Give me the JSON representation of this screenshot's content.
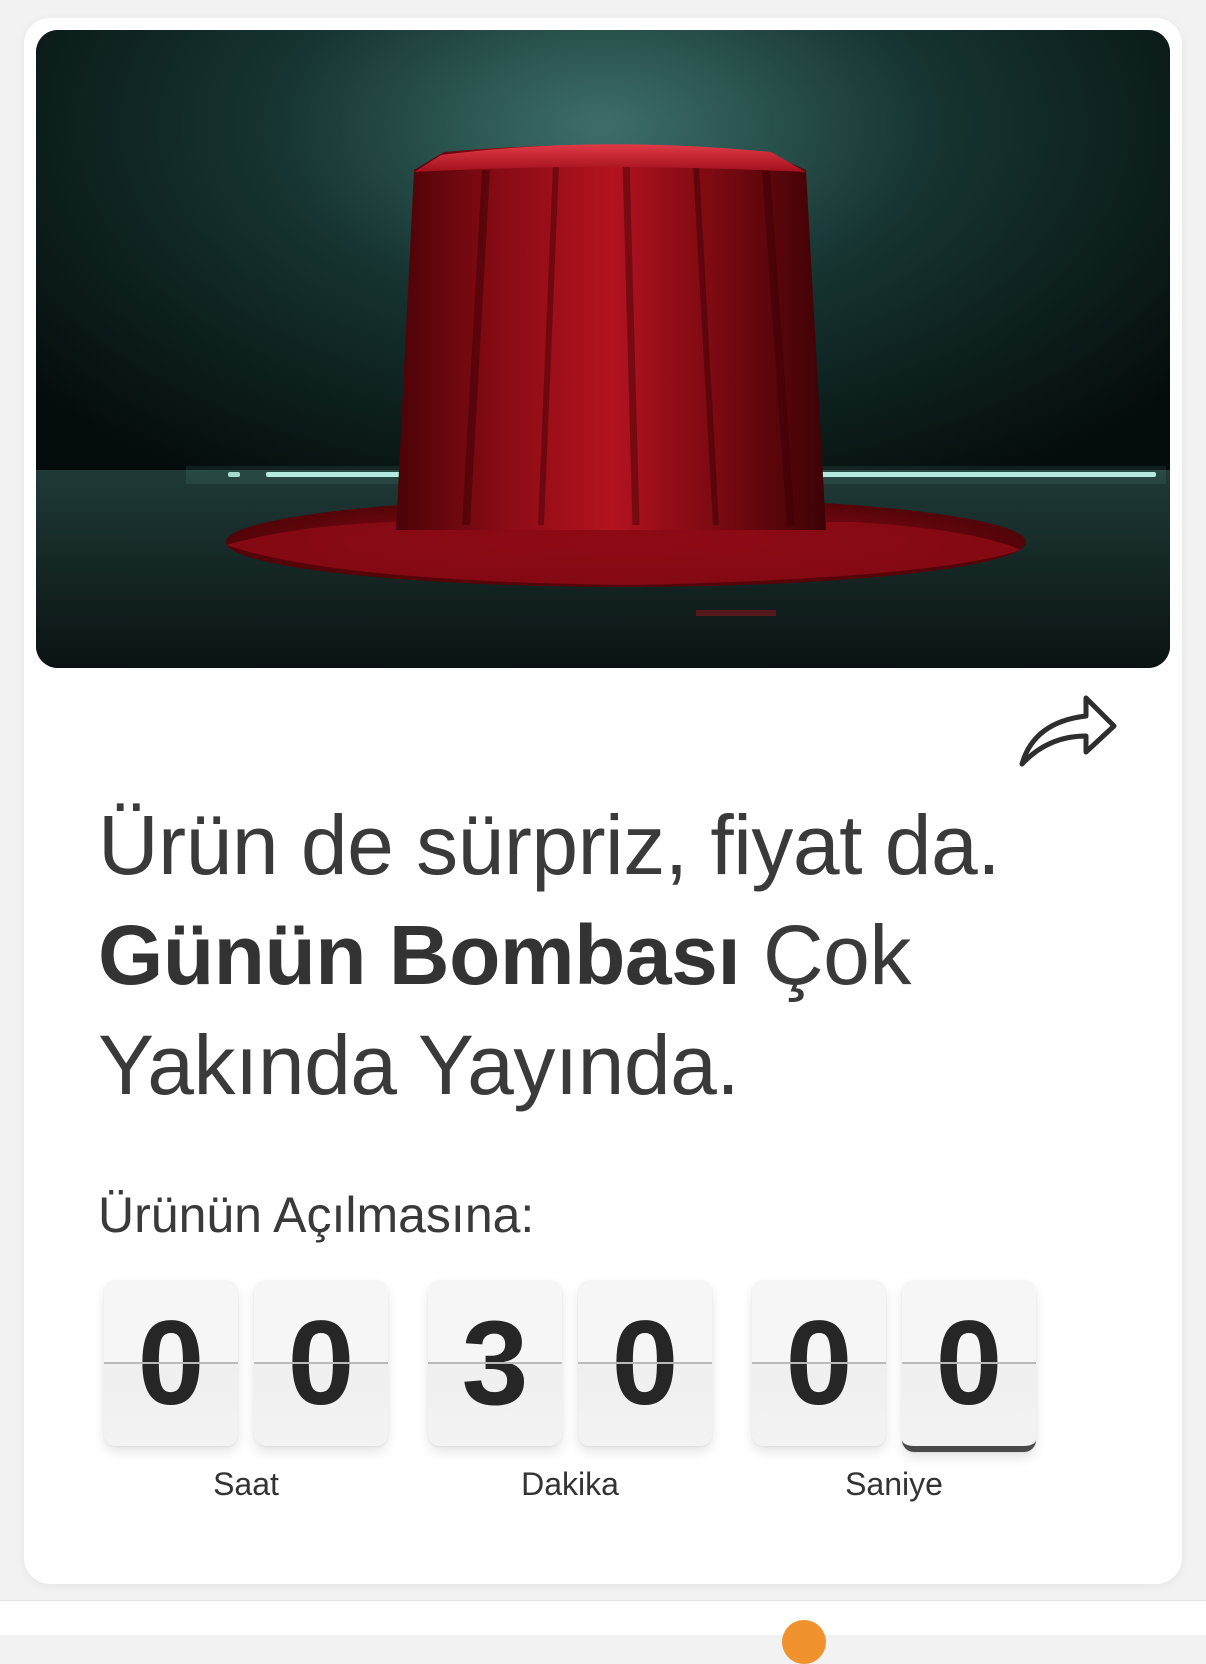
{
  "headline": {
    "line1": "Ürün de sürpriz, fiyat da.",
    "bold": "Günün Bombası",
    "rest1": " Çok",
    "line3": "Yakında Yayında."
  },
  "countdown": {
    "label": "Ürünün Açılmasına:",
    "digits": [
      "0",
      "0",
      "3",
      "0",
      "0",
      "0"
    ],
    "units": [
      "Saat",
      "Dakika",
      "Saniye"
    ]
  },
  "icons": {
    "share": "share-arrow-icon",
    "hero": "covered-product-image"
  },
  "colors": {
    "text": "#3a3a3a",
    "cloth": "#b0101c",
    "glow": "#9ff5e6",
    "accent": "#f0922d"
  }
}
